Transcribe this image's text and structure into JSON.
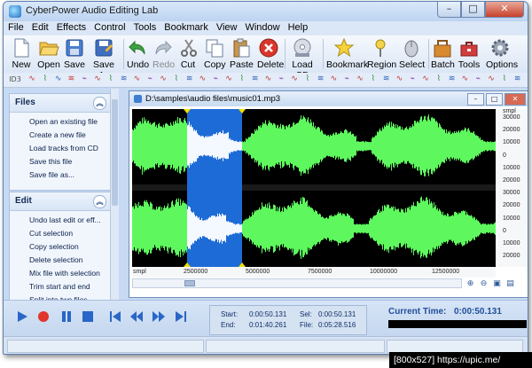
{
  "window": {
    "title": "CyberPower Audio Editing Lab",
    "btn_min": "–",
    "btn_max": "□",
    "btn_close": "✕"
  },
  "menu": [
    "File",
    "Edit",
    "Effects",
    "Control",
    "Tools",
    "Bookmark",
    "View",
    "Window",
    "Help"
  ],
  "toolbar": {
    "new": "New",
    "open": "Open",
    "save": "Save",
    "save_as": "Save As",
    "undo": "Undo",
    "redo": "Redo",
    "cut": "Cut",
    "copy": "Copy",
    "paste": "Paste",
    "delete": "Delete",
    "load_cd": "Load CD",
    "bookmark": "Bookmark",
    "region": "Region",
    "select": "Select",
    "batch": "Batch",
    "tools": "Tools",
    "options": "Options"
  },
  "toolbar2": {
    "id3": "ID3"
  },
  "sidebar": {
    "files": {
      "header": "Files",
      "items": [
        "Open an existing file",
        "Create a new file",
        "Load tracks from CD",
        "Save this file",
        "Save file as..."
      ]
    },
    "edit": {
      "header": "Edit",
      "items": [
        "Undo last edit or eff...",
        "Cut selection",
        "Copy selection",
        "Delete selection",
        "Mix file with selection",
        "Trim start and end",
        "Split into two files"
      ]
    }
  },
  "document": {
    "path": "D:\\samples\\audio files\\music01.mp3",
    "amp_unit": "smpl",
    "amp_ticks": [
      "30000",
      "20000",
      "10000",
      "0",
      "10000",
      "20000",
      "30000",
      "20000",
      "10000",
      "0",
      "10000",
      "20000"
    ],
    "time_unit": "smpl",
    "time_ticks": [
      "2500000",
      "5000000",
      "7500000",
      "10000000",
      "12500000"
    ]
  },
  "player": {
    "start_label": "Start:",
    "start_value": "0:00:50.131",
    "end_label": "End:",
    "end_value": "0:01:40.261",
    "sel_label": "Sel:",
    "sel_value": "0:00:50.131",
    "file_label": "File:",
    "file_value": "0:05:28.516",
    "current_time_label": "Current Time:",
    "current_time_value": "0:00:50.131"
  },
  "watermark": "[800x527] https://upic.me/",
  "colors": {
    "waveform": "#5ef85e",
    "selection": "#1d6bd6",
    "wave_bg": "#000000",
    "marker": "#f2e000"
  }
}
